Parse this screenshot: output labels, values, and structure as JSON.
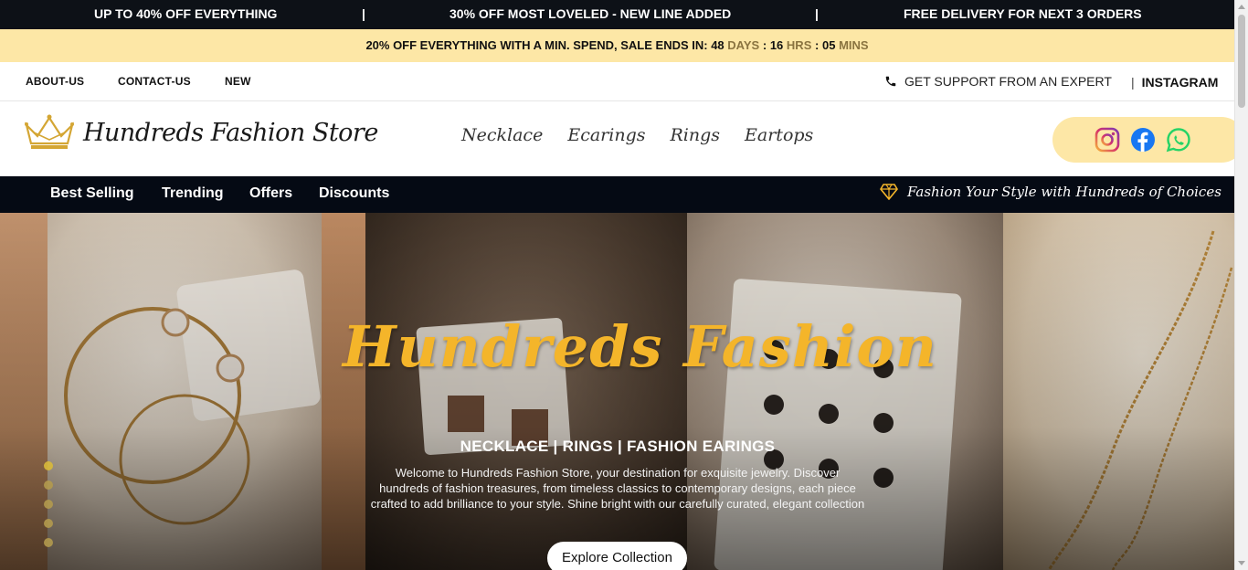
{
  "promo": {
    "item1": "UP TO 40% OFF EVERYTHING",
    "sep1": "|",
    "item2": "30% OFF MOST LOVELED - NEW LINE ADDED",
    "sep2": "|",
    "item3": "FREE DELIVERY FOR NEXT 3 ORDERS"
  },
  "sale": {
    "text": "20% OFF EVERYTHING WITH A MIN. SPEND, SALE ENDS IN: ",
    "days": "48",
    "days_unit": "DAYS",
    "hours": "16",
    "hours_unit": "HRS",
    "mins": "05",
    "mins_unit": "MINS",
    "colon": ":"
  },
  "utility": {
    "about": "ABOUT-US",
    "contact": "CONTACT-US",
    "new": "NEW",
    "support": "GET SUPPORT FROM AN EXPERT",
    "sep": "|",
    "instagram": "INSTAGRAM"
  },
  "header": {
    "logo_text": "Hundreds Fashion Store",
    "categories": [
      "Necklace",
      "Ecarings",
      "Rings",
      "Eartops"
    ]
  },
  "nav": {
    "items": [
      "Best Selling",
      "Trending",
      "Offers",
      "Discounts"
    ],
    "tagline": "Fashion Your Style with Hundreds of Choices"
  },
  "hero": {
    "title": "Hundreds Fashion",
    "subtitle": "NECKLACE | RINGS | FASHION EARINGS",
    "description": "Welcome to Hundreds Fashion Store, your destination for exquisite jewelry. Discover hundreds of fashion treasures, from timeless classics to contemporary designs, each piece crafted to add brilliance to your style. Shine bright with our carefully curated, elegant collection",
    "button": "Explore Collection",
    "slide_count": 5,
    "active_slide": 1
  },
  "colors": {
    "dark": "#050a14",
    "accent_yellow": "#fde7a6",
    "title_gold": "#f4b52a"
  },
  "icons": [
    "phone-icon",
    "crown-logo-icon",
    "instagram-icon",
    "facebook-icon",
    "whatsapp-icon",
    "diamond-icon"
  ]
}
